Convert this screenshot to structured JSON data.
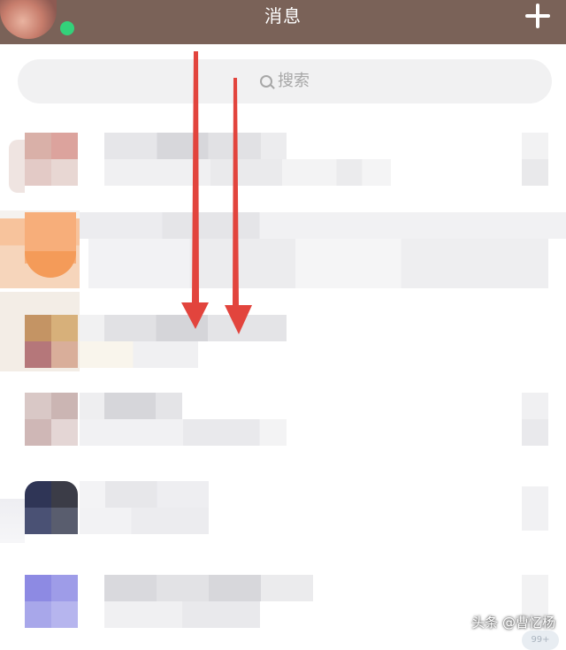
{
  "header": {
    "title": "消息",
    "status_color": "#33d17a",
    "background": "#7a6258"
  },
  "search": {
    "placeholder": "搜索"
  },
  "conversations": [
    {
      "avatar_color": "#d3a79f"
    },
    {
      "avatar_color": "#f5a96b"
    },
    {
      "avatar_color": "#b77b5b"
    },
    {
      "avatar_color": "#d8c5c5"
    },
    {
      "avatar_color": "#3c4265"
    },
    {
      "avatar_color": "#9a98e6"
    }
  ],
  "row_badge": "99+",
  "annotation": {
    "arrows_color": "#e2443d"
  },
  "watermark": "头条 @曹忆杨"
}
